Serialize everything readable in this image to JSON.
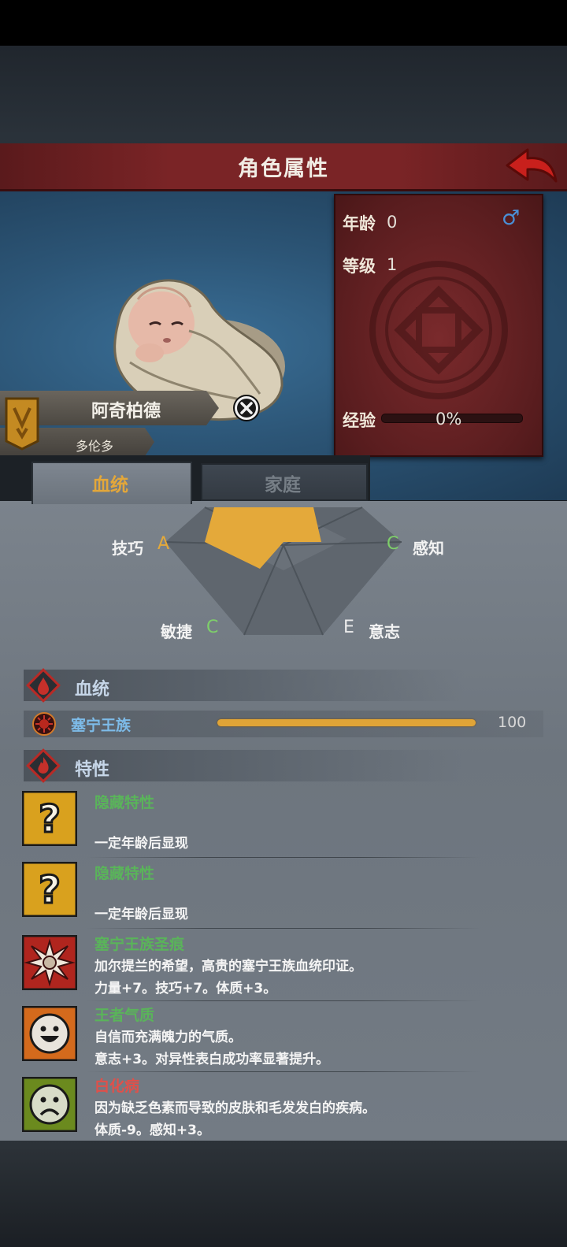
{
  "header": {
    "title": "角色属性"
  },
  "stats": {
    "age_label": "年龄",
    "age_value": "0",
    "level_label": "等级",
    "level_value": "1",
    "gender_symbol": "♂",
    "xp_label": "经验",
    "xp_value": "0%"
  },
  "character": {
    "name": "阿奇柏德",
    "city": "多伦多"
  },
  "tabs": [
    {
      "label": "血统"
    },
    {
      "label": "家庭"
    }
  ],
  "attributes": {
    "skill_label": "技巧",
    "skill_grade": "A",
    "perception_label": "感知",
    "perception_grade": "C",
    "agility_label": "敏捷",
    "agility_grade": "C",
    "will_label": "意志",
    "will_grade": "E"
  },
  "bloodline_section": {
    "title": "血统",
    "name": "塞宁王族",
    "value": "100"
  },
  "traits_section": {
    "title": "特性"
  },
  "traits": [
    {
      "name": "隐藏特性",
      "line1": "",
      "line2": "一定年龄后显现",
      "color": "#5ab45a"
    },
    {
      "name": "隐藏特性",
      "line1": "",
      "line2": "一定年龄后显现",
      "color": "#5ab45a"
    },
    {
      "name": "塞宁王族圣痕",
      "line1": "加尔提兰的希望，高贵的塞宁王族血统印证。",
      "line2": "力量+7。技巧+7。体质+3。",
      "color": "#5ab45a"
    },
    {
      "name": "王者气质",
      "line1": "自信而充满魄力的气质。",
      "line2": "意志+3。对异性表白成功率显著提升。",
      "color": "#5ab45a"
    },
    {
      "name": "白化病",
      "line1": "因为缺乏色素而导致的皮肤和毛发发白的疾病。",
      "line2": "体质-9。感知+3。",
      "color": "#e0504a"
    }
  ],
  "colors": {
    "accent_gold": "#e3a73a",
    "banner_red": "#7a2426",
    "grade_green": "#7ecf6a"
  }
}
